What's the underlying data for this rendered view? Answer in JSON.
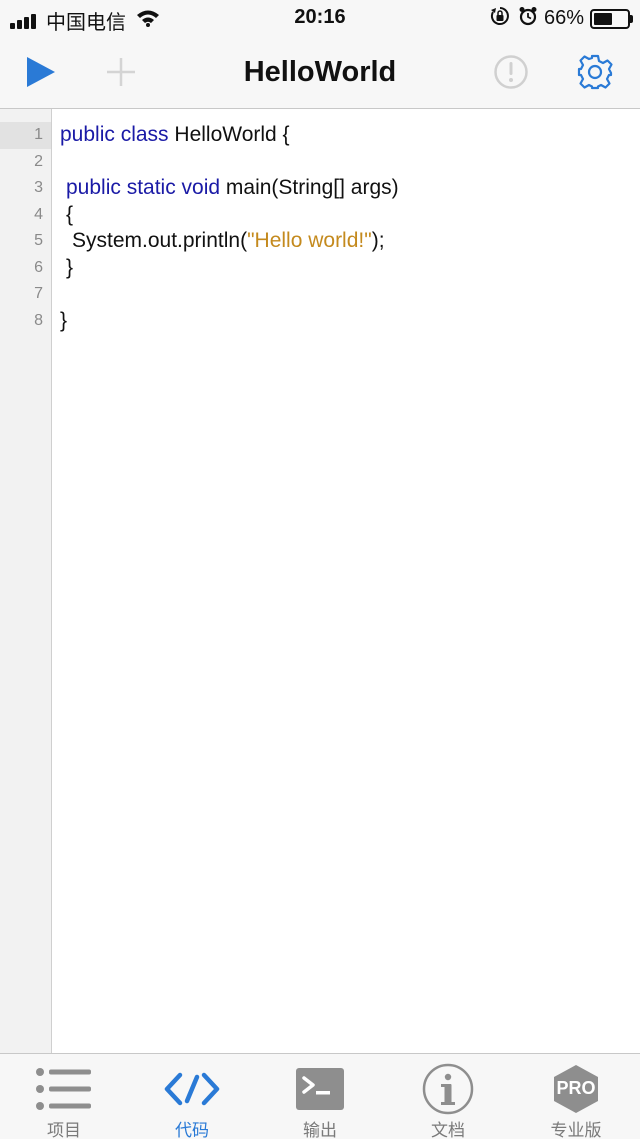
{
  "status_bar": {
    "carrier": "中国电信",
    "time": "20:16",
    "battery_percent_label": "66%",
    "battery_level": 0.66,
    "icons": [
      "signal-icon",
      "wifi-icon",
      "orientation-lock-icon",
      "alarm-icon",
      "battery-icon"
    ]
  },
  "nav": {
    "title": "HelloWorld",
    "icons": [
      "run-icon",
      "add-icon",
      "warning-icon",
      "settings-icon"
    ]
  },
  "editor": {
    "active_line": 1,
    "lines": [
      {
        "n": "1",
        "indent": 0,
        "parts": [
          {
            "t": "public class",
            "c": "kw"
          },
          {
            "t": " HelloWorld {",
            "c": ""
          }
        ]
      },
      {
        "n": "2",
        "indent": 0,
        "parts": []
      },
      {
        "n": "3",
        "indent": 1,
        "parts": [
          {
            "t": "public static void",
            "c": "kw"
          },
          {
            "t": " main(String[] args)",
            "c": ""
          }
        ]
      },
      {
        "n": "4",
        "indent": 1,
        "parts": [
          {
            "t": "{",
            "c": ""
          }
        ]
      },
      {
        "n": "5",
        "indent": 2,
        "parts": [
          {
            "t": "System.out.println(",
            "c": ""
          },
          {
            "t": "\"Hello world!\"",
            "c": "str"
          },
          {
            "t": ");",
            "c": ""
          }
        ]
      },
      {
        "n": "6",
        "indent": 1,
        "parts": [
          {
            "t": "}",
            "c": ""
          }
        ]
      },
      {
        "n": "7",
        "indent": 0,
        "parts": []
      },
      {
        "n": "8",
        "indent": 0,
        "parts": [
          {
            "t": "}",
            "c": ""
          }
        ]
      }
    ]
  },
  "tabs": [
    {
      "label": "项目",
      "icon": "list-icon",
      "active": false
    },
    {
      "label": "代码",
      "icon": "code-icon",
      "active": true
    },
    {
      "label": "输出",
      "icon": "terminal-icon",
      "active": false
    },
    {
      "label": "文档",
      "icon": "info-icon",
      "active": false
    },
    {
      "label": "专业版",
      "icon": "pro-badge-icon",
      "badge_text": "PRO",
      "active": false
    }
  ],
  "colors": {
    "accent": "#2a7ad6",
    "keyword": "#1a1aa6",
    "string": "#c48a1e",
    "inactive": "#7a7a7a"
  }
}
